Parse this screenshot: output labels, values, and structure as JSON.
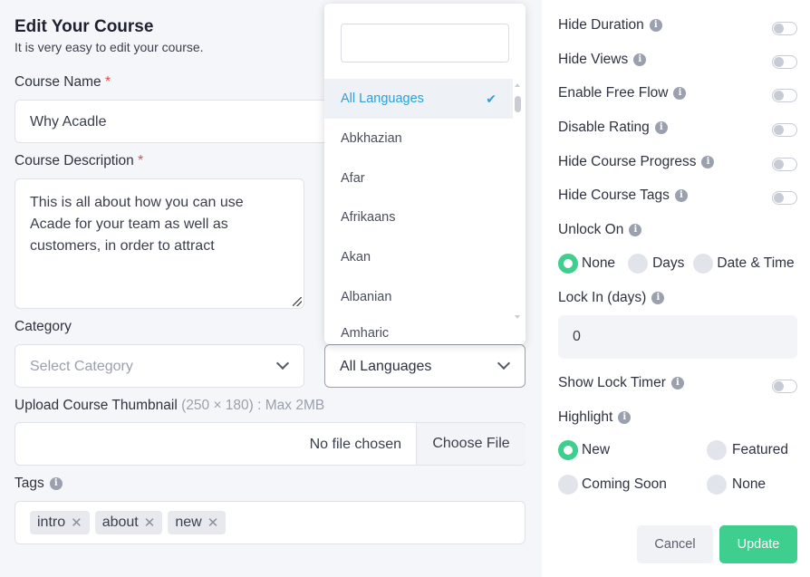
{
  "header": {
    "title": "Edit Your Course",
    "subtitle": "It is very easy to edit your course."
  },
  "course_name": {
    "label": "Course Name",
    "required": "*",
    "value": "Why Acadle"
  },
  "course_description": {
    "label": "Course Description",
    "required": "*",
    "value": "This is all about how you can use Acade for your team as well as customers, in order to attract"
  },
  "category": {
    "label": "Category",
    "placeholder": "Select Category"
  },
  "language": {
    "selected": "All Languages",
    "options": [
      "All Languages",
      "Abkhazian",
      "Afar",
      "Afrikaans",
      "Akan",
      "Albanian",
      "Amharic"
    ]
  },
  "upload": {
    "label": "Upload Course Thumbnail",
    "hint": "(250 × 180) : Max 2MB",
    "status": "No file chosen",
    "button": "Choose File"
  },
  "tags": {
    "label": "Tags",
    "items": [
      "intro",
      "about",
      "new"
    ]
  },
  "settings": {
    "hide_duration": "Hide Duration",
    "hide_views": "Hide Views",
    "enable_free_flow": "Enable Free Flow",
    "disable_rating": "Disable Rating",
    "hide_course_progress": "Hide Course Progress",
    "hide_course_tags": "Hide Course Tags",
    "unlock_on": "Unlock On",
    "unlock_options": [
      "None",
      "Days",
      "Date & Time"
    ],
    "unlock_selected": "None",
    "lock_in": "Lock In (days)",
    "lock_in_value": "0",
    "show_lock_timer": "Show Lock Timer",
    "highlight": "Highlight",
    "highlight_options": [
      "New",
      "Featured",
      "Coming Soon",
      "None"
    ],
    "highlight_selected": "New"
  },
  "actions": {
    "cancel": "Cancel",
    "update": "Update"
  },
  "colors": {
    "accent_green": "#3ecf8e",
    "link_blue": "#2e9fd8",
    "required_red": "#e5484d"
  }
}
